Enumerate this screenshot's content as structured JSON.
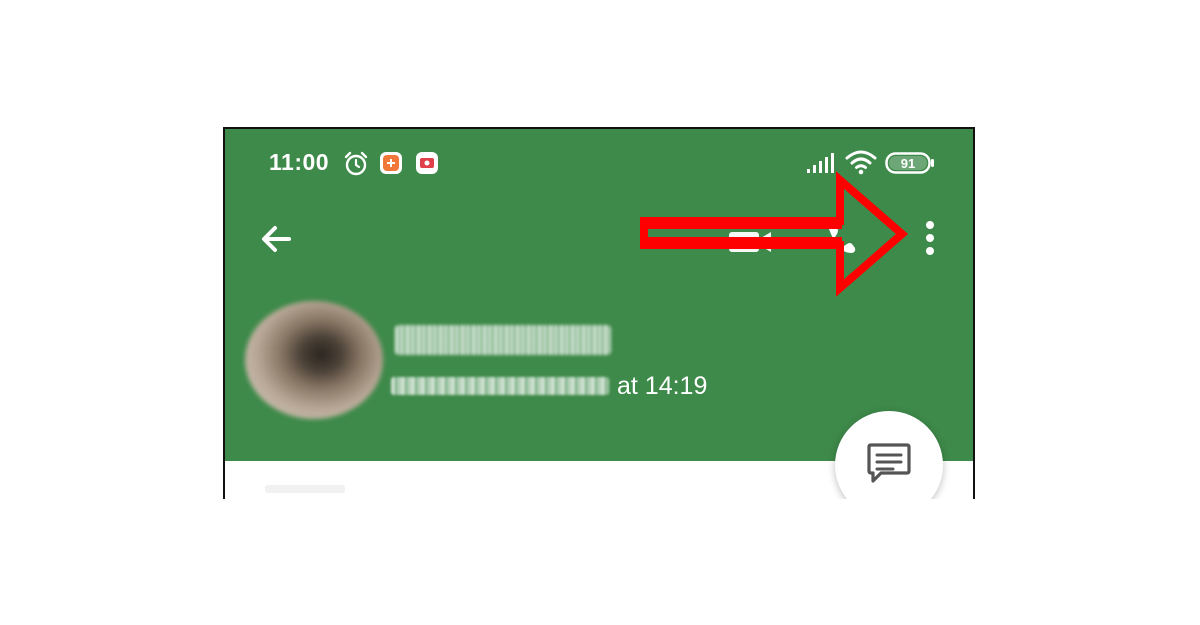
{
  "statusbar": {
    "time": "11:00",
    "battery_level": "91",
    "icons": [
      "alarm-icon",
      "notification-app-icon",
      "notification-app-icon-2",
      "signal-icon",
      "wifi-icon",
      "battery-icon"
    ]
  },
  "toolbar": {
    "back_icon": "arrow-left-icon",
    "actions": [
      "video-call-icon",
      "voice-call-icon",
      "more-vert-icon"
    ]
  },
  "contact": {
    "last_seen_suffix": "at 14:19"
  },
  "fab": {
    "icon": "message-icon"
  },
  "colors": {
    "header_green": "#3e8a4a",
    "annotation_red": "#ff0000",
    "white": "#ffffff"
  }
}
